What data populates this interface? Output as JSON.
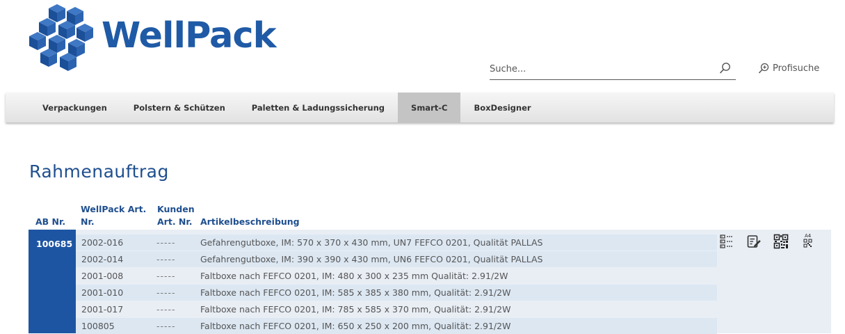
{
  "brand": {
    "name": "WellPack",
    "color": "#1f5aa6"
  },
  "search": {
    "placeholder": "Suche...",
    "value": "",
    "icon": "search-icon"
  },
  "pro_search": {
    "label": "Profisuche",
    "icon": "zoom-search-icon"
  },
  "nav": {
    "items": [
      {
        "label": "Verpackungen",
        "active": false
      },
      {
        "label": "Polstern & Schützen",
        "active": false
      },
      {
        "label": "Paletten & Ladungssicherung",
        "active": false
      },
      {
        "label": "Smart-C",
        "active": true
      },
      {
        "label": "BoxDesigner",
        "active": false
      }
    ]
  },
  "page": {
    "title": "Rahmenauftrag"
  },
  "table": {
    "headers": {
      "ab_nr": "AB Nr.",
      "wellpack_art_1": "WellPack Art.",
      "wellpack_art_2": "Nr.",
      "kunden_1": "Kunden",
      "kunden_2": "Art. Nr.",
      "beschreibung": "Artikelbeschreibung"
    },
    "ab_number": "100685",
    "rows": [
      {
        "art": "2002-016",
        "kunde": "-----",
        "desc": "Gefahrengutboxe, IM: 570 x 370 x 430 mm, UN7 FEFCO 0201, Qualität PALLAS"
      },
      {
        "art": "2002-014",
        "kunde": "-----",
        "desc": "Gefahrengutboxe, IM: 390 x 390 x 430 mm, UN6 FEFCO 0201, Qualität PALLAS"
      },
      {
        "art": "2001-008",
        "kunde": "-----",
        "desc": "Faltboxe nach FEFCO 0201, IM: 480 x 300 x 235 mm Qualität: 2.91/2W"
      },
      {
        "art": "2001-010",
        "kunde": "-----",
        "desc": "Faltboxe nach FEFCO 0201, IM: 585 x 385 x 380 mm, Qualität: 2.91/2W"
      },
      {
        "art": "2001-017",
        "kunde": "-----",
        "desc": "Faltboxe nach FEFCO 0201, IM: 785 x 585 x 370 mm, Qualität: 2.91/2W"
      },
      {
        "art": "100805",
        "kunde": "-----",
        "desc": "Faltboxe nach FEFCO 0201, IM: 650 x 250 x 200 mm, Qualität: 2.91/2W"
      }
    ],
    "actions": [
      {
        "icon": "barcode-list-icon"
      },
      {
        "icon": "edit-document-icon"
      },
      {
        "icon": "qr-code-icon"
      },
      {
        "icon": "a4-qr-code-icon",
        "label": "A4"
      }
    ]
  }
}
